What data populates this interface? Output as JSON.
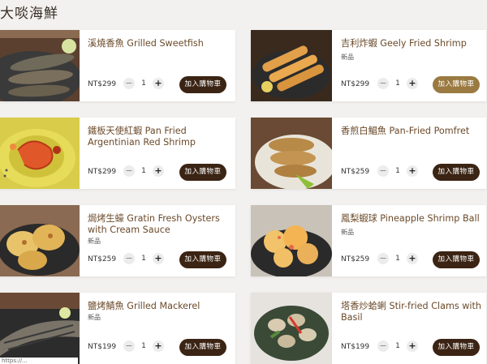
{
  "section": {
    "title": "大啖海鮮"
  },
  "common": {
    "cart_label": "加入購物車",
    "minus": "−",
    "plus": "+"
  },
  "products": [
    {
      "name": "溪燒香魚 Grilled Sweetfish",
      "badge": "",
      "price": "NT$299",
      "qty": "1",
      "image": "grilled-sweetfish"
    },
    {
      "name": "吉利炸蝦 Geely Fried Shrimp",
      "badge": "新品",
      "price": "NT$299",
      "qty": "1",
      "image": "fried-shrimp"
    },
    {
      "name": "鐵板天使紅蝦 Pan Fried Argentinian Red Shrimp",
      "badge": "",
      "price": "NT$299",
      "qty": "1",
      "image": "red-shrimp"
    },
    {
      "name": "香煎白鯧魚 Pan-Fried Pomfret",
      "badge": "",
      "price": "NT$259",
      "qty": "1",
      "image": "pomfret"
    },
    {
      "name": "焗烤生蠔 Gratin Fresh Oysters with Cream Sauce",
      "badge": "新品",
      "price": "NT$259",
      "qty": "1",
      "image": "oysters"
    },
    {
      "name": "鳳梨蝦球 Pineapple Shrimp Ball",
      "badge": "新品",
      "price": "NT$259",
      "qty": "1",
      "image": "shrimp-balls"
    },
    {
      "name": "鹽烤鯖魚 Grilled Mackerel",
      "badge": "新品",
      "price": "NT$199",
      "qty": "1",
      "image": "mackerel"
    },
    {
      "name": "塔香炒蛤蜊 Stir-fried Clams with Basil",
      "badge": "",
      "price": "NT$199",
      "qty": "1",
      "image": "clams"
    }
  ],
  "status_url": "https://..."
}
